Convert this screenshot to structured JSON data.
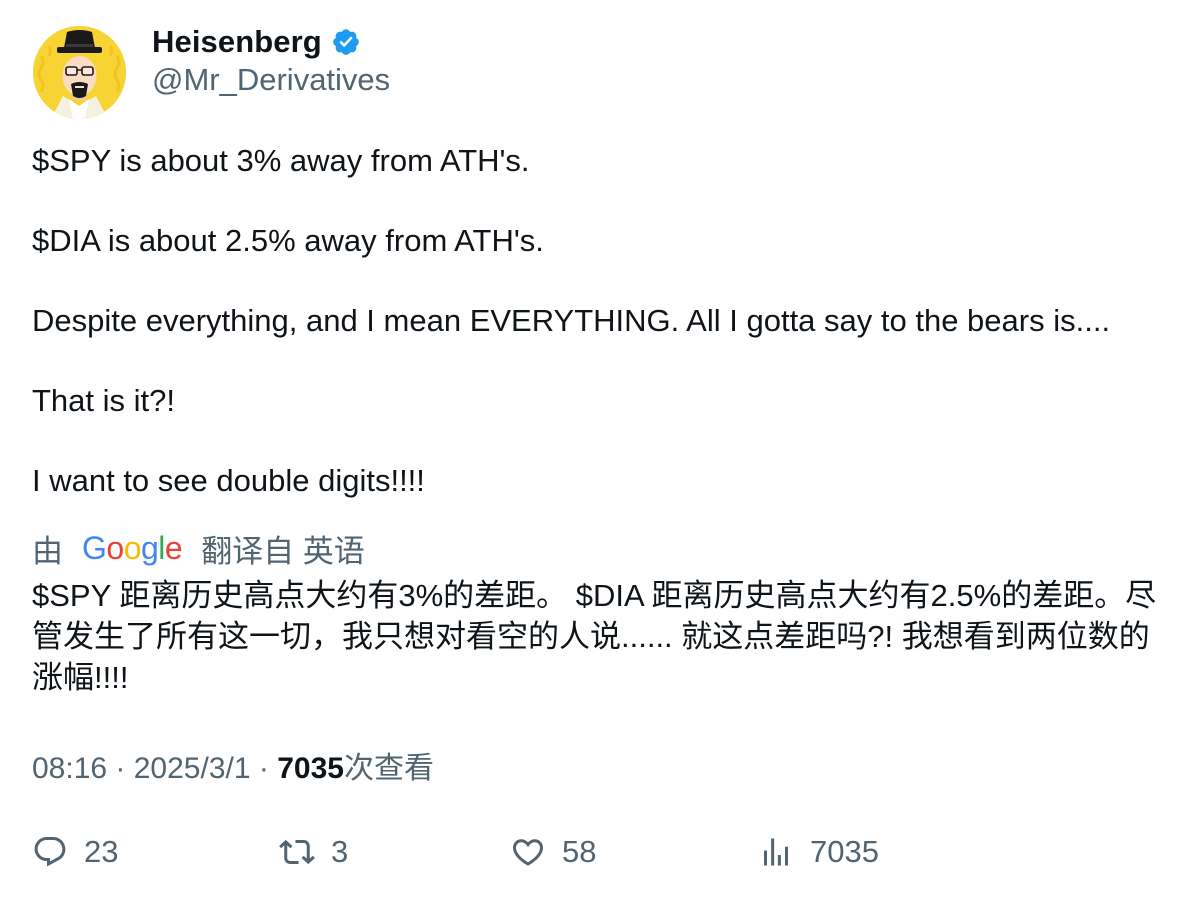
{
  "author": {
    "display_name": "Heisenberg",
    "handle": "@Mr_Derivatives",
    "verified": true,
    "avatar_icon": "heisenberg-avatar"
  },
  "tweet": {
    "paragraphs": [
      "$SPY is about 3% away from ATH's.",
      "$DIA is about 2.5% away from ATH's.",
      "Despite everything, and I mean EVERYTHING. All I gotta say to the bears is....",
      "That is it?!",
      "I want to see double digits!!!!"
    ]
  },
  "translation": {
    "prefix": "由",
    "provider_logo": "Google",
    "suffix": "翻译自 英语",
    "text": "$SPY 距离历史高点大约有3%的差距。 $DIA 距离历史高点大约有2.5%的差距。尽管发生了所有这一切，我只想对看空的人说...... 就这点差距吗?! 我想看到两位数的涨幅!!!!"
  },
  "meta": {
    "time": "08:16",
    "separator": "·",
    "date": "2025/3/1",
    "views_count": "7035",
    "views_label": "次查看"
  },
  "actions": {
    "reply": {
      "icon": "reply-icon",
      "count": "23"
    },
    "retweet": {
      "icon": "retweet-icon",
      "count": "3"
    },
    "like": {
      "icon": "heart-icon",
      "count": "58"
    },
    "views": {
      "icon": "views-icon",
      "count": "7035"
    }
  },
  "colors": {
    "text_primary": "#0f1419",
    "text_secondary": "#536471",
    "verified_blue": "#1d9bf0",
    "avatar_yellow": "#f7d433"
  }
}
